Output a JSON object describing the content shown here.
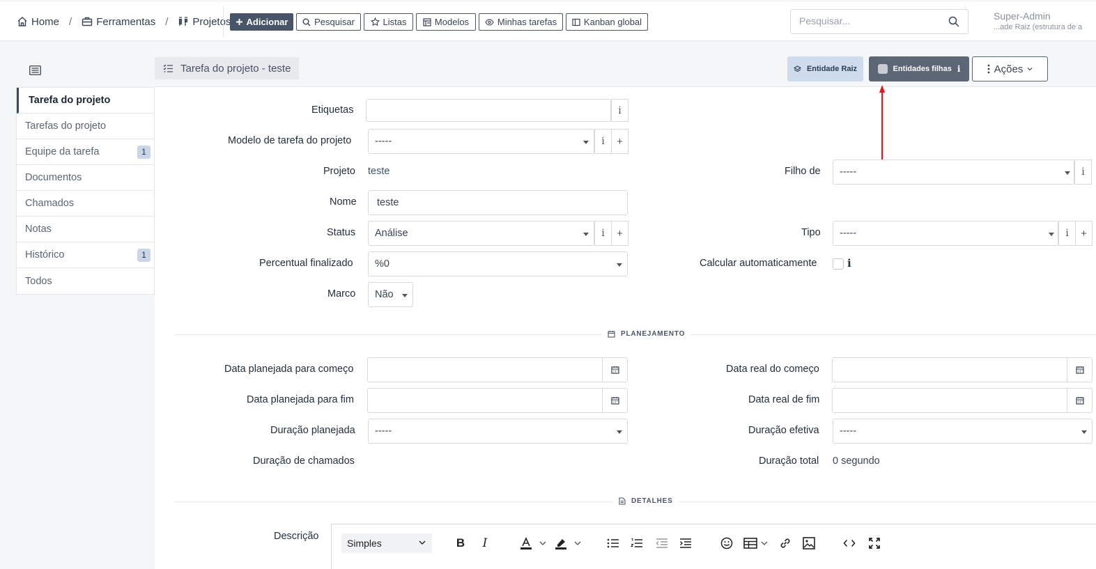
{
  "breadcrumb": {
    "items": [
      {
        "label": "Home",
        "icon": "home-icon"
      },
      {
        "label": "Ferramentas",
        "icon": "briefcase-icon"
      },
      {
        "label": "Projetos",
        "icon": "project-icon"
      }
    ],
    "separator": "/"
  },
  "toolbar": {
    "add": "Adicionar",
    "search": "Pesquisar",
    "lists": "Listas",
    "templates": "Modelos",
    "my_tasks": "Minhas tarefas",
    "kanban": "Kanban global"
  },
  "global_search": {
    "placeholder": "Pesquisar..."
  },
  "user": {
    "name": "Super-Admin",
    "entity": "...ade Raiz (estrutura de a"
  },
  "sidebar": {
    "items": [
      {
        "label": "Tarefa do projeto",
        "active": true
      },
      {
        "label": "Tarefas do projeto"
      },
      {
        "label": "Equipe da tarefa",
        "badge": "1"
      },
      {
        "label": "Documentos"
      },
      {
        "label": "Chamados"
      },
      {
        "label": "Notas"
      },
      {
        "label": "Histórico",
        "badge": "1"
      },
      {
        "label": "Todos"
      }
    ]
  },
  "header": {
    "title": "Tarefa do projeto - teste",
    "root_entity": "Entidade Raiz",
    "child_entities": "Entidades filhas",
    "actions": "Ações"
  },
  "form": {
    "tags": {
      "label": "Etiquetas",
      "value": ""
    },
    "task_template": {
      "label": "Modelo de tarefa do projeto",
      "value": "-----"
    },
    "project": {
      "label": "Projeto",
      "value": "teste"
    },
    "child_of": {
      "label": "Filho de",
      "value": "-----"
    },
    "name": {
      "label": "Nome",
      "value": "teste"
    },
    "status": {
      "label": "Status",
      "value": "Análise"
    },
    "type": {
      "label": "Tipo",
      "value": "-----"
    },
    "percent_done": {
      "label": "Percentual finalizado",
      "value": "%0"
    },
    "auto_calc": {
      "label": "Calcular automaticamente",
      "checked": false
    },
    "milestone": {
      "label": "Marco",
      "value": "Não"
    }
  },
  "planning": {
    "title": "PLANEJAMENTO",
    "planned_start": {
      "label": "Data planejada para começo",
      "value": ""
    },
    "real_start": {
      "label": "Data real do começo",
      "value": ""
    },
    "planned_end": {
      "label": "Data planejada para fim",
      "value": ""
    },
    "real_end": {
      "label": "Data real de fim",
      "value": ""
    },
    "planned_duration": {
      "label": "Duração planejada",
      "value": "-----"
    },
    "effective_duration": {
      "label": "Duração efetiva",
      "value": "-----"
    },
    "tickets_duration": {
      "label": "Duração de chamados",
      "value": ""
    },
    "total_duration": {
      "label": "Duração total",
      "value": "0 segundo"
    }
  },
  "details": {
    "title": "DETALHES",
    "description": {
      "label": "Descrição",
      "format": "Simples"
    }
  },
  "colors": {
    "primary": "#485468",
    "root_entity_bg": "#cfdcee",
    "child_entity_bg": "#5c6675",
    "annotation_arrow": "#e8121b"
  }
}
